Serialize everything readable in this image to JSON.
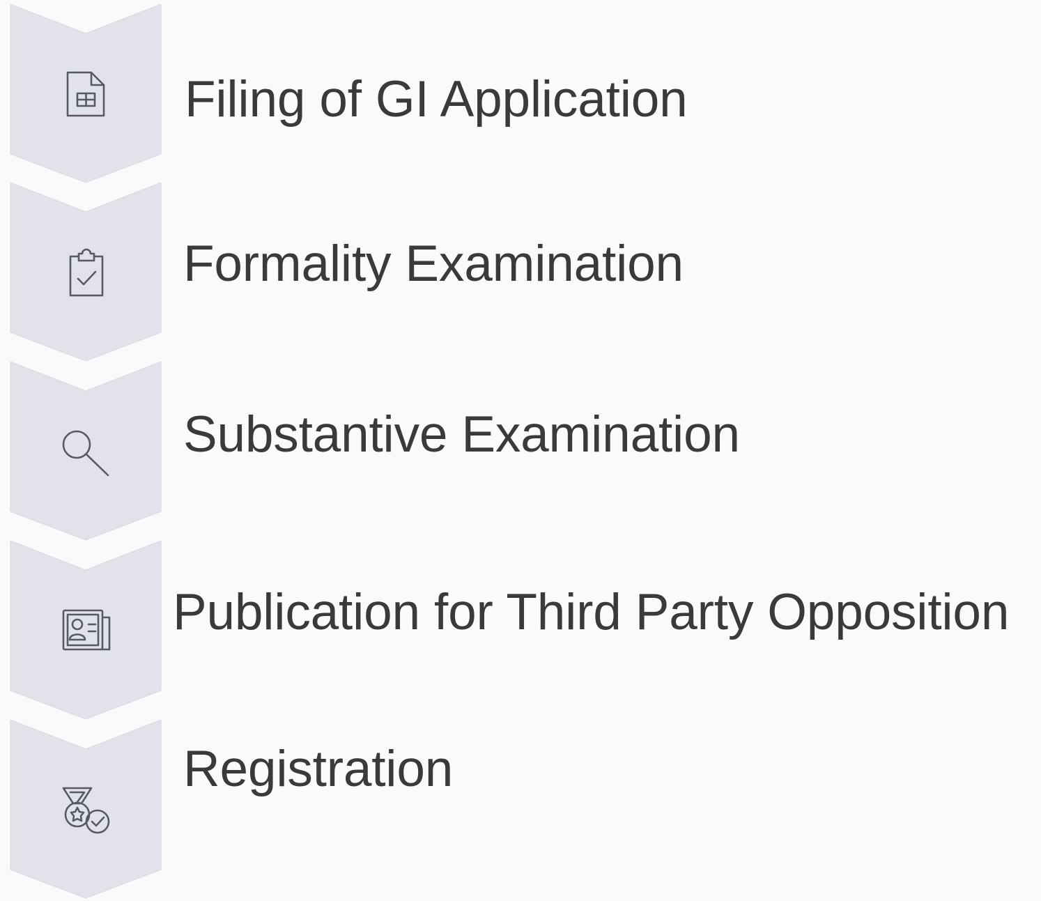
{
  "steps": [
    {
      "label": "Filing of GI Application",
      "icon": "spreadsheet-document-icon"
    },
    {
      "label": "Formality Examination",
      "icon": "clipboard-check-icon"
    },
    {
      "label": "Substantive Examination",
      "icon": "magnifier-search-icon"
    },
    {
      "label": "Publication for Third Party Opposition",
      "icon": "newspaper-profile-icon"
    },
    {
      "label": "Registration",
      "icon": "medal-award-check-icon"
    }
  ],
  "colors": {
    "background": "#fafafa",
    "chevron_fill": "#e2e3ea",
    "icon_stroke": "#555a63",
    "text": "#3a3a3a"
  }
}
